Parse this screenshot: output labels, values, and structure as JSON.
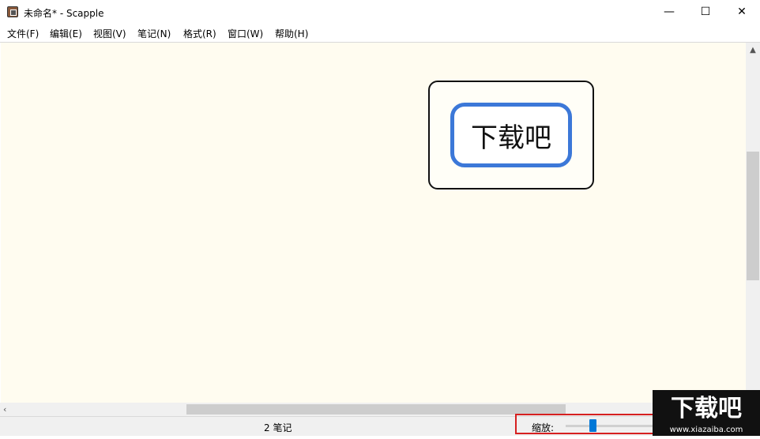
{
  "window": {
    "title": "未命名* - Scapple",
    "minimize_glyph": "—",
    "maximize_glyph": "☐",
    "close_glyph": "✕"
  },
  "menu": [
    {
      "label": "文件(F)"
    },
    {
      "label": "编辑(E)"
    },
    {
      "label": "视图(V)"
    },
    {
      "label": "笔记(N)"
    },
    {
      "label": "格式(R)"
    },
    {
      "label": "窗口(W)"
    },
    {
      "label": "帮助(H)"
    }
  ],
  "canvas": {
    "background": "#fffcf0",
    "note": {
      "text": "下载吧",
      "border_color": "#3c78d8"
    }
  },
  "status": {
    "note_count": "2 笔记",
    "zoom_label": "缩放:",
    "zoom_level": 0.3
  },
  "watermark": {
    "text": "下载吧",
    "url": "www.xiazaiba.com"
  }
}
